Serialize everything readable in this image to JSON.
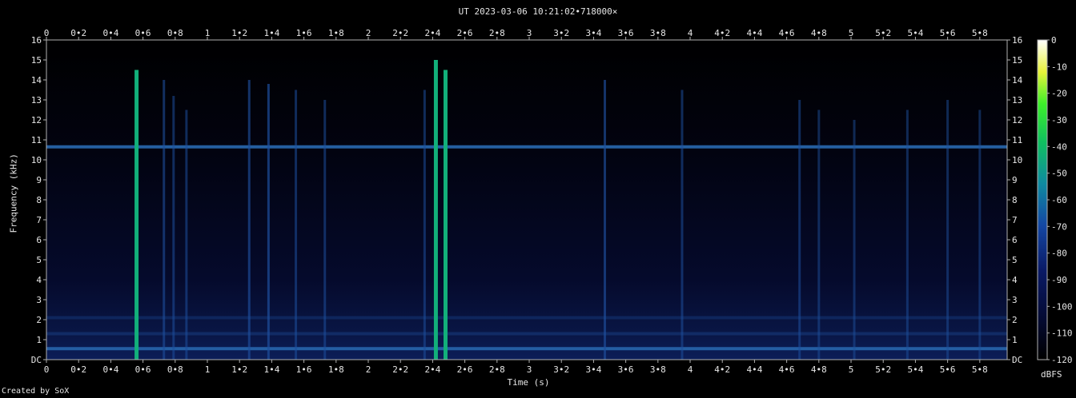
{
  "title": "UT 2023-03-06 10:21:02•718000×",
  "credit": "Created by SoX",
  "chart_data": {
    "type": "heatmap",
    "title": "UT 2023-03-06 10:21:02•718000×",
    "xlabel": "Time (s)",
    "ylabel": "Frequency (kHz)",
    "xlim": [
      0,
      5.97
    ],
    "ylim": [
      0,
      16
    ],
    "x_ticks": [
      "0",
      "0•2",
      "0•4",
      "0•6",
      "0•8",
      "1",
      "1•2",
      "1•4",
      "1•6",
      "1•8",
      "2",
      "2•2",
      "2•4",
      "2•6",
      "2•8",
      "3",
      "3•2",
      "3•4",
      "3•6",
      "3•8",
      "4",
      "4•2",
      "4•4",
      "4•6",
      "4•8",
      "5",
      "5•2",
      "5•4",
      "5•6",
      "5•8"
    ],
    "y_ticks": [
      "DC",
      "1",
      "2",
      "3",
      "4",
      "5",
      "6",
      "7",
      "8",
      "9",
      "10",
      "11",
      "12",
      "13",
      "14",
      "15",
      "16"
    ],
    "colorbar": {
      "label": "dBFS",
      "ticks": [
        "0",
        "-10",
        "-20",
        "-30",
        "-40",
        "-50",
        "-60",
        "-70",
        "-80",
        "-90",
        "-100",
        "-110",
        "-120"
      ],
      "range": [
        -120,
        0
      ]
    },
    "horizontal_lines": [
      {
        "freq_khz": 10.65,
        "strength": 0.6
      },
      {
        "freq_khz": 0.55,
        "strength": 0.55
      },
      {
        "freq_khz": 1.3,
        "strength": 0.3
      },
      {
        "freq_khz": 2.1,
        "strength": 0.2
      }
    ],
    "transients": [
      {
        "t": 0.56,
        "fmax": 14.5,
        "strength": 0.8
      },
      {
        "t": 0.73,
        "fmax": 14.0,
        "strength": 0.4
      },
      {
        "t": 0.79,
        "fmax": 13.2,
        "strength": 0.35
      },
      {
        "t": 0.87,
        "fmax": 12.5,
        "strength": 0.35
      },
      {
        "t": 1.26,
        "fmax": 14.0,
        "strength": 0.45
      },
      {
        "t": 1.38,
        "fmax": 13.8,
        "strength": 0.5
      },
      {
        "t": 1.55,
        "fmax": 13.5,
        "strength": 0.35
      },
      {
        "t": 1.73,
        "fmax": 13.0,
        "strength": 0.35
      },
      {
        "t": 2.35,
        "fmax": 13.5,
        "strength": 0.35
      },
      {
        "t": 2.42,
        "fmax": 15.0,
        "strength": 0.95
      },
      {
        "t": 2.48,
        "fmax": 14.5,
        "strength": 0.8
      },
      {
        "t": 3.47,
        "fmax": 14.0,
        "strength": 0.45
      },
      {
        "t": 3.95,
        "fmax": 13.5,
        "strength": 0.35
      },
      {
        "t": 4.68,
        "fmax": 13.0,
        "strength": 0.35
      },
      {
        "t": 4.8,
        "fmax": 12.5,
        "strength": 0.3
      },
      {
        "t": 5.02,
        "fmax": 12.0,
        "strength": 0.3
      },
      {
        "t": 5.35,
        "fmax": 12.5,
        "strength": 0.3
      },
      {
        "t": 5.6,
        "fmax": 13.0,
        "strength": 0.3
      },
      {
        "t": 5.8,
        "fmax": 12.5,
        "strength": 0.3
      }
    ]
  }
}
